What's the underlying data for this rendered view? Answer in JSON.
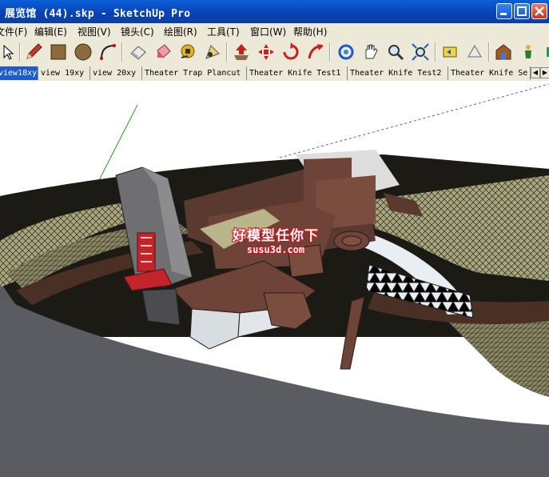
{
  "window": {
    "title": "展览馆 (44).skp - SketchUp Pro"
  },
  "menu": {
    "items": [
      "文件(F)",
      "编辑(E)",
      "视图(V)",
      "镜头(C)",
      "绘图(R)",
      "工具(T)",
      "窗口(W)",
      "帮助(H)"
    ]
  },
  "toolbar": {
    "tools": [
      "select-icon",
      "pencil-icon",
      "rectangle-icon",
      "circle-icon",
      "arc-icon",
      "eraser-icon",
      "paint-bucket-icon",
      "tape-measure-icon",
      "push-pull-icon",
      "move-icon",
      "rotate-icon",
      "follow-me-icon",
      "offset-icon",
      "orbit-icon",
      "pan-icon",
      "zoom-icon",
      "zoom-extents-icon",
      "previous-view-icon",
      "next-view-icon",
      "warehouse-icon",
      "components-icon",
      "extension-icon"
    ]
  },
  "scenes": {
    "tabs": [
      "view18xy",
      "view 19xy",
      "view 20xy",
      "Theater Trap Plancut",
      "Theater Knife Test1",
      "Theater Knife Test2",
      "Theater Knife Se"
    ],
    "active_index": 0
  },
  "watermark": {
    "line1": "好模型任你下",
    "line2": "susu3d.com"
  },
  "colors": {
    "title_bar": "#0842b4",
    "active_scene": "#1e5ccc",
    "ground": "#5b5b62",
    "roof": "#6e4438",
    "terrain": "#b0ab7e"
  }
}
